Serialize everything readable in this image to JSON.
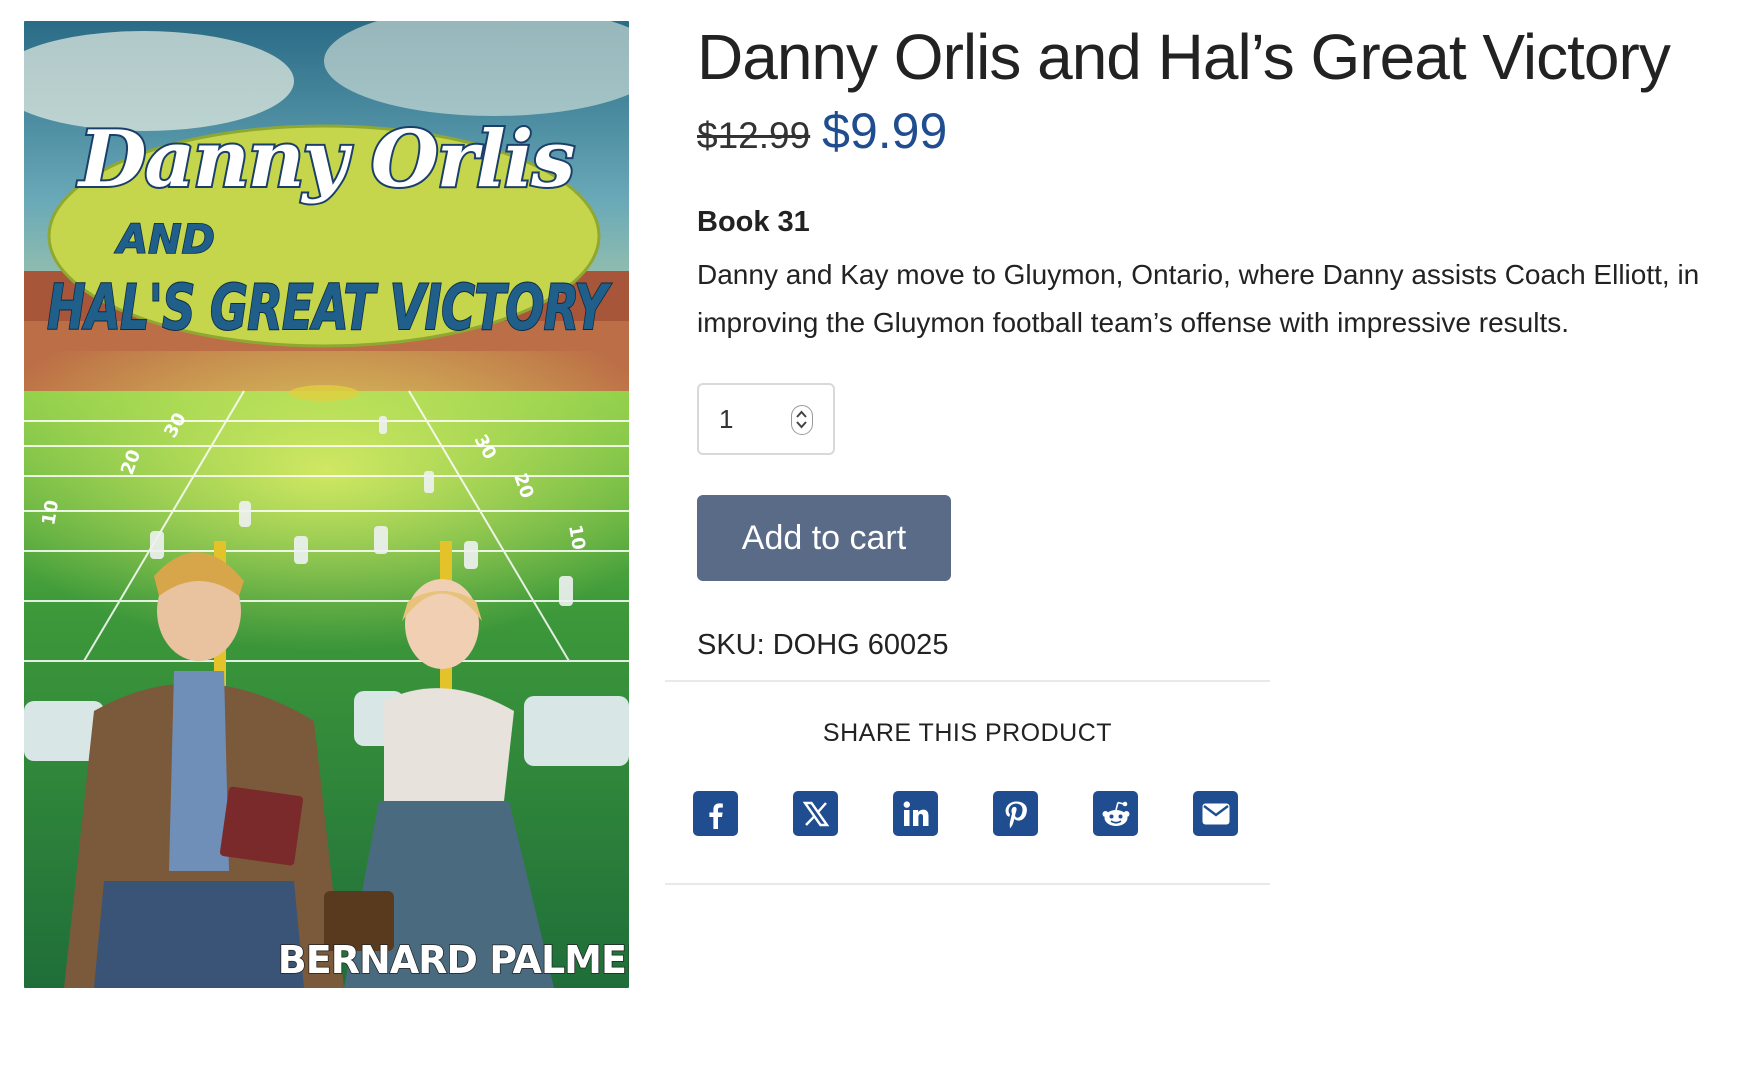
{
  "cover": {
    "title_line_1": "Danny Orlis",
    "title_line_2": "AND",
    "title_line_3": "HAL'S GREAT VICTORY",
    "author": "BERNARD PALMER",
    "yard_markers": [
      "10",
      "20",
      "30",
      "30",
      "20",
      "10"
    ]
  },
  "product": {
    "title": "Danny Orlis and Hal’s Great Victory",
    "price_old": "$12.99",
    "price_new": "$9.99",
    "book_label": "Book 31",
    "description": "Danny and Kay move to Gluymon, Ontario, where Danny assists Coach Elliott, in improving the Gluymon football team’s offense with impressive results.",
    "quantity": "1",
    "add_to_cart_label": "Add to cart",
    "sku": "SKU: DOHG 60025"
  },
  "share": {
    "heading": "SHARE THIS PRODUCT",
    "icons": [
      "facebook-icon",
      "x-icon",
      "linkedin-icon",
      "pinterest-icon",
      "reddit-icon",
      "email-icon"
    ]
  },
  "colors": {
    "accent": "#1f4d8f",
    "button": "#5a6b88"
  }
}
